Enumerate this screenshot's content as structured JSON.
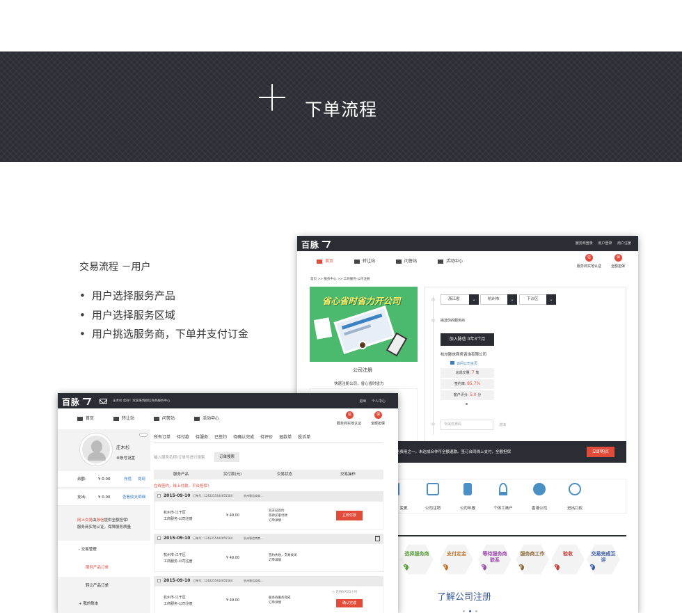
{
  "banner": {
    "title": "下单流程"
  },
  "intro": {
    "title": "交易流程 －用户",
    "bullets": [
      "用户选择服务产品",
      "用户选择服务区域",
      "用户挑选服务商，下单并支付订金"
    ]
  },
  "brand": {
    "logo_text": "百脉"
  },
  "back_window": {
    "top_links": [
      "服务商登录",
      "用户登录",
      "用户注册"
    ],
    "nav": [
      "首页",
      "转让站",
      "问答站",
      "活动中心"
    ],
    "badges": [
      {
        "glyph": "信",
        "label": "服务商实地认证"
      },
      {
        "glyph": "保",
        "label": "全额担保"
      }
    ],
    "breadcrumb": "首页 >> 服务中心 >> 工商服务-公司注册",
    "product": {
      "slogan": "省心省时省力开公司",
      "title": "公司注册",
      "subtitle": "快速注册公司，省心省时省力"
    },
    "regions": [
      "浙江省",
      "杭州市",
      "下沙区"
    ],
    "choose_label": "挑选你的服务商",
    "join_label": "加入脉信 0年3个月",
    "company": "杭州脉信商务咨询有限公司",
    "visit_label": "访问公司主页",
    "stats": [
      {
        "label": "总成交量:",
        "value": "7",
        "unit": "笔"
      },
      {
        "label": "签约率:",
        "value": "85.7%",
        "unit": ""
      },
      {
        "label": "客户评分:",
        "value": "5.0",
        "unit": "分"
      }
    ],
    "coupon_placeholder": "专属优惠码",
    "coupon_button": "选填",
    "bar_text": "务费用之一，未达成合作可全额退款。签订合同线上支付，全额担保",
    "buy_button": "立即购买",
    "services": [
      "变更",
      "公司注销",
      "公司年报",
      "个体工商户",
      "香港公司",
      "进出口权"
    ],
    "steps": [
      {
        "num": "2",
        "text": "选择服务商",
        "color": "#5a9e3a"
      },
      {
        "num": "3",
        "text": "支付定金",
        "color": "#c0762a"
      },
      {
        "num": "5",
        "text": "等待服务商联系",
        "color": "#9b4aa8"
      },
      {
        "num": "6",
        "text": "服务商工作",
        "color": "#8a6a3a"
      },
      {
        "num": "7",
        "text": "验收",
        "color": "#c83a3a"
      },
      {
        "num": "8",
        "text": "交易完成互评",
        "color": "#3a5aa8"
      }
    ],
    "learn_title": "了解公司注册"
  },
  "front_window": {
    "welcome": "庄木杉  您好！欢迎来到脉信商务服务中心",
    "top_links": [
      "退出",
      "个人中心"
    ],
    "nav": [
      "首页",
      "转让站",
      "问答站",
      "活动中心"
    ],
    "badges": [
      {
        "glyph": "信",
        "label": "服务商实地认证"
      },
      {
        "glyph": "保",
        "label": "全额担保"
      }
    ],
    "user": {
      "name": "庄木杉",
      "settings": "账号设置"
    },
    "balance": {
      "label": "余额:",
      "value": "¥ 0.00",
      "links": [
        "充值",
        "提现"
      ]
    },
    "expense": {
      "label": "支出:",
      "value": "¥ 0.00",
      "link": "查看收支明细"
    },
    "promo": {
      "prefix": "网上交易",
      "mid": "由",
      "brand": "脉信",
      "suffix": "提供全额担保!",
      "line2": "服务商实地认证，保障服务质量"
    },
    "menu": [
      "- 交易管理",
      "服务产品订单",
      "转让产品订单",
      "+ 我的账本"
    ],
    "tabs": [
      "所有订单",
      "待付款",
      "待服务",
      "已签约",
      "待确认完成",
      "待评价",
      "退款单",
      "投诉单"
    ],
    "search_placeholder": "输入服务名称/订单号进行搜索",
    "search_button": "订单搜索",
    "columns": [
      "服务产品",
      "实付款(元)",
      "交易状态",
      "交易操作"
    ],
    "notice": "在线签约，线上付款，平台担保！",
    "orders": [
      {
        "date": "2015-09-10",
        "order_no": "订单号：1263255444655584",
        "vendor": "杭州脉信商商...",
        "product_line1": "杭州市-江干区",
        "product_line2": "工商服务-公司注册",
        "price": "¥ 49.00",
        "status": [
          "双方已签约",
          "等待买家付款",
          "订单详情"
        ],
        "action": "立即付款"
      },
      {
        "date": "2015-09-10",
        "order_no": "订单号：1263255444655584",
        "vendor": "杭州脉信商商...",
        "product_line1": "杭州市-江干区",
        "product_line2": "工商服务-公司注册",
        "price": "¥ 49.00",
        "status": [
          "签约失败，交易关闭",
          "订单详情"
        ],
        "action": ""
      },
      {
        "date": "2015-09-10",
        "order_no": "订单号：1263255444655584",
        "vendor": "杭州脉信商商...",
        "product_line1": "杭州市-江干区",
        "product_line2": "工商服务-公司注册",
        "price": "¥ 49.00",
        "status": [
          "服务商服务完成",
          "订单详情"
        ],
        "action": "确认完成",
        "timer": "还剩9天23小时"
      }
    ]
  },
  "colors": {
    "accent": "#e24a3a",
    "dark": "#2a2d34",
    "banner": "#2b2e35"
  }
}
